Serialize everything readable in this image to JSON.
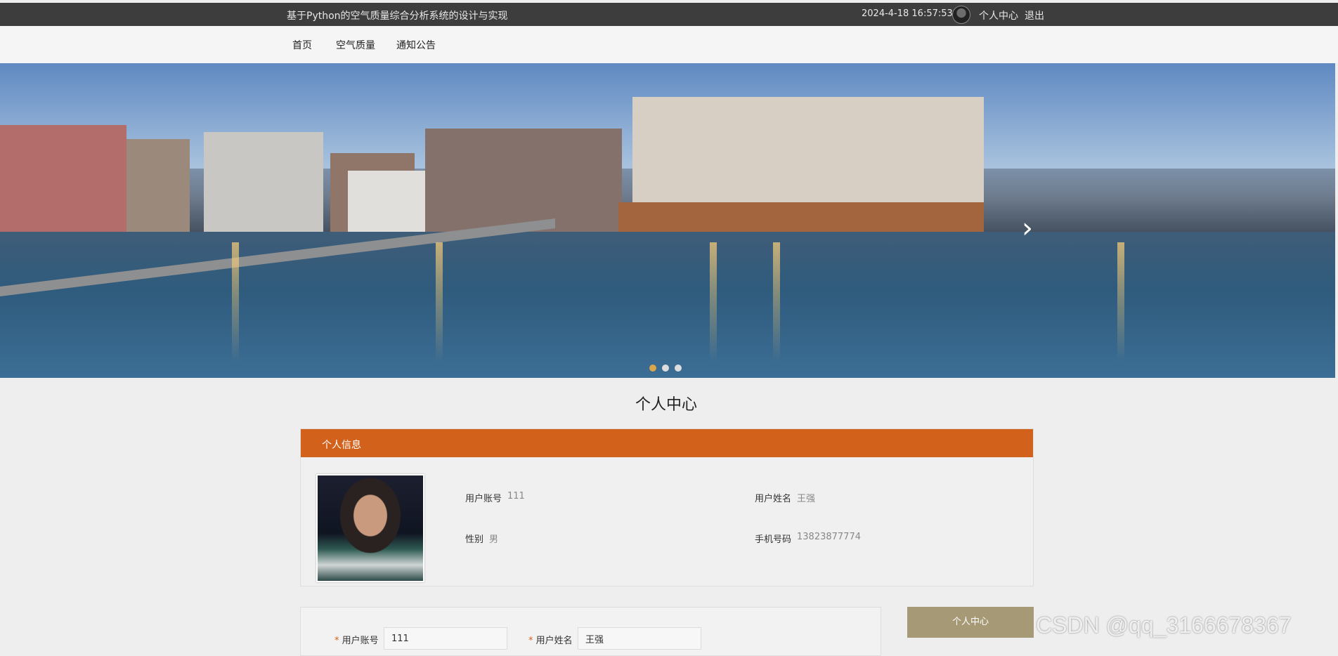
{
  "topbar": {
    "site_title": "基于Python的空气质量综合分析系统的设计与实现",
    "datetime": "2024-4-18 16:57:53",
    "user_center": "个人中心",
    "logout": "退出"
  },
  "nav": {
    "items": [
      {
        "label": "首页"
      },
      {
        "label": "空气质量"
      },
      {
        "label": "通知公告"
      }
    ]
  },
  "banner": {
    "next_icon": "chevron-right-icon",
    "dots": 3,
    "active_dot": 0
  },
  "page_title": "个人中心",
  "info_card": {
    "header": "个人信息",
    "fields": {
      "account_label": "用户账号",
      "account_value": "111",
      "name_label": "用户姓名",
      "name_value": "王强",
      "gender_label": "性别",
      "gender_value": "男",
      "phone_label": "手机号码",
      "phone_value": "13823877774"
    },
    "accent_color": "#d2621b"
  },
  "form": {
    "account_label": "用户账号",
    "account_value": "111",
    "name_label": "用户姓名",
    "name_value": "王强",
    "required_mark": "*"
  },
  "side_button": {
    "label": "个人中心",
    "color": "#a59976"
  },
  "watermark": "CSDN @qq_3166678367"
}
